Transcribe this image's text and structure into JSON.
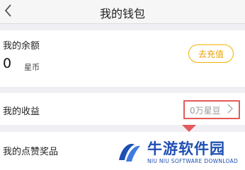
{
  "header": {
    "title": "我的钱包"
  },
  "balance": {
    "label": "我的余额",
    "value": "0",
    "unit": "星币",
    "recharge_label": "去充值"
  },
  "income": {
    "label": "我的收益",
    "value": "0万星豆"
  },
  "likes": {
    "label": "我的点赞奖品"
  },
  "watermark": {
    "name": "牛游软件园",
    "subtitle": "NIU NIU SOFTWARE DOWNLOAD"
  },
  "colors": {
    "accent": "#f0b400",
    "highlight": "#e45a5a",
    "brand": "#1e4fb3"
  },
  "icons": {
    "back": "chevron-left-icon",
    "chevron": "chevron-right-icon"
  }
}
